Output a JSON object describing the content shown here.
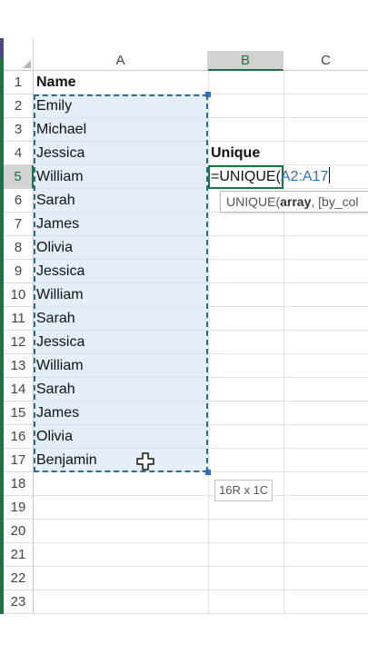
{
  "columns": [
    "A",
    "B",
    "C"
  ],
  "rows": [
    "1",
    "2",
    "3",
    "4",
    "5",
    "6",
    "7",
    "8",
    "9",
    "10",
    "11",
    "12",
    "13",
    "14",
    "15",
    "16",
    "17",
    "18",
    "19",
    "20",
    "21",
    "22",
    "23"
  ],
  "cells": {
    "header_name": "Name",
    "names": [
      "Emily",
      "Michael",
      "Jessica",
      "William",
      "Sarah",
      "James",
      "Olivia",
      "Jessica",
      "William",
      "Sarah",
      "Jessica",
      "William",
      "Sarah",
      "James",
      "Olivia",
      "Benjamin"
    ],
    "unique_label": "Unique"
  },
  "formula": {
    "prefix": "=UNIQUE(",
    "ref": "A2:A17"
  },
  "tooltip": {
    "fn": "UNIQUE(",
    "arg1": "array",
    "rest": ", [by_col"
  },
  "size_tip": "16R x 1C",
  "colors": {
    "accent": "#1e7145",
    "reference": "#2f6fb7",
    "range_fill": "#d2e2f3"
  }
}
